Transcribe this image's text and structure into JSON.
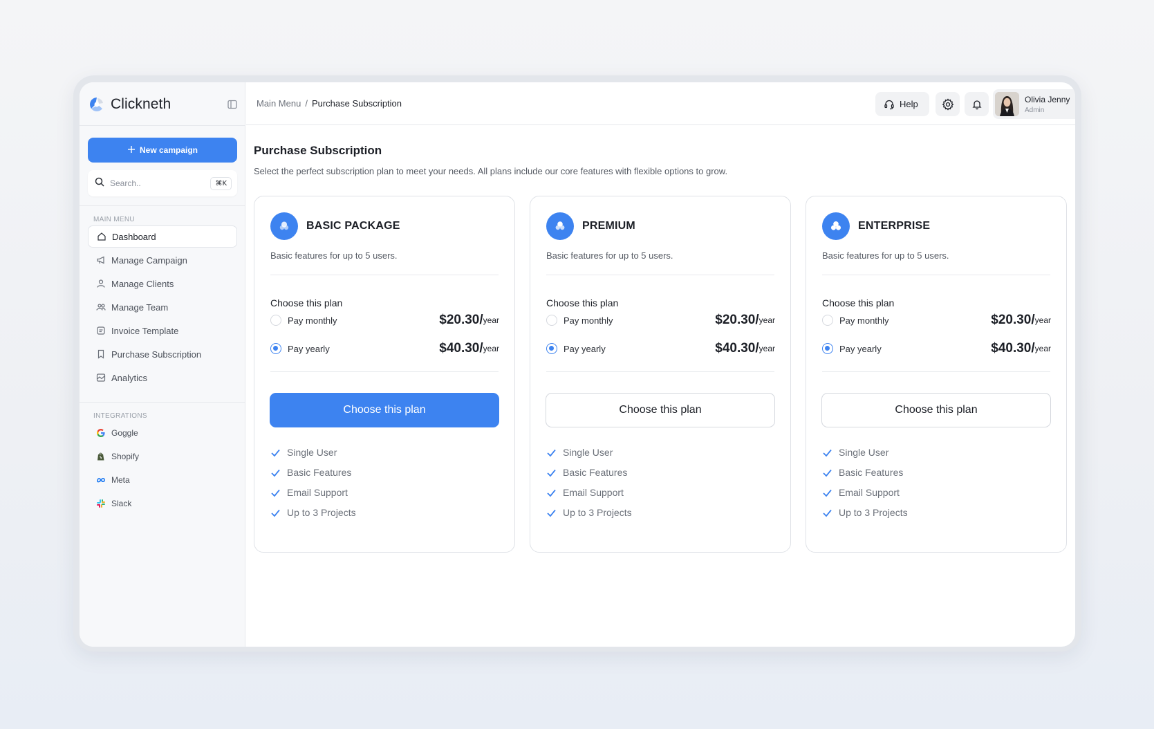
{
  "app": {
    "name": "Clickneth"
  },
  "sidebar": {
    "new_campaign_label": "New campaign",
    "search": {
      "placeholder": "Search..",
      "shortcut": "⌘K"
    },
    "main_menu_label": "MAIN MENU",
    "items": [
      {
        "label": "Dashboard",
        "icon": "home-icon",
        "active": true
      },
      {
        "label": "Manage Campaign",
        "icon": "megaphone-icon"
      },
      {
        "label": "Manage Clients",
        "icon": "user-icon"
      },
      {
        "label": "Manage Team",
        "icon": "users-icon"
      },
      {
        "label": "Invoice Template",
        "icon": "invoice-icon"
      },
      {
        "label": "Purchase Subscription",
        "icon": "bookmark-icon"
      },
      {
        "label": "Analytics",
        "icon": "chart-icon"
      }
    ],
    "integrations_label": "INTEGRATIONS",
    "integrations": [
      {
        "label": "Goggle",
        "icon": "google-icon"
      },
      {
        "label": "Shopify",
        "icon": "shopify-icon"
      },
      {
        "label": "Meta",
        "icon": "meta-icon"
      },
      {
        "label": "Slack",
        "icon": "slack-icon"
      }
    ]
  },
  "header": {
    "breadcrumb": {
      "parent": "Main Menu",
      "separator": "/",
      "current": "Purchase Subscription"
    },
    "help_label": "Help",
    "user": {
      "name": "Olivia Jenny",
      "role": "Admin"
    }
  },
  "main": {
    "title": "Purchase Subscription",
    "subtitle": "Select the perfect subscription plan to meet your needs. All plans include our core features with flexible options to grow."
  },
  "plans": [
    {
      "name": "BASIC PACKAGE",
      "description": "Basic features for up to 5 users.",
      "choose_label": "Choose this plan",
      "options": [
        {
          "label": "Pay monthly",
          "price": "$20.30/",
          "period": "year",
          "selected": false
        },
        {
          "label": "Pay yearly",
          "price": "$40.30/",
          "period": "year",
          "selected": true
        }
      ],
      "cta": "Choose this plan",
      "cta_style": "primary",
      "features": [
        "Single User",
        "Basic Features",
        "Email Support",
        "Up to 3 Projects"
      ]
    },
    {
      "name": "PREMIUM",
      "description": "Basic features for up to 5 users.",
      "choose_label": "Choose this plan",
      "options": [
        {
          "label": "Pay monthly",
          "price": "$20.30/",
          "period": "year",
          "selected": false
        },
        {
          "label": "Pay yearly",
          "price": "$40.30/",
          "period": "year",
          "selected": true
        }
      ],
      "cta": "Choose this plan",
      "cta_style": "outline",
      "features": [
        "Single User",
        "Basic Features",
        "Email Support",
        "Up to 3 Projects"
      ]
    },
    {
      "name": "ENTERPRISE",
      "description": "Basic features for up to 5 users.",
      "choose_label": "Choose this plan",
      "options": [
        {
          "label": "Pay monthly",
          "price": "$20.30/",
          "period": "year",
          "selected": false
        },
        {
          "label": "Pay yearly",
          "price": "$40.30/",
          "period": "year",
          "selected": true
        }
      ],
      "cta": "Choose this plan",
      "cta_style": "outline",
      "features": [
        "Single User",
        "Basic Features",
        "Email Support",
        "Up to 3 Projects"
      ]
    }
  ],
  "colors": {
    "accent": "#3d83f0",
    "sidebar_bg": "#f7f8fa",
    "border": "#dfe2e7"
  }
}
